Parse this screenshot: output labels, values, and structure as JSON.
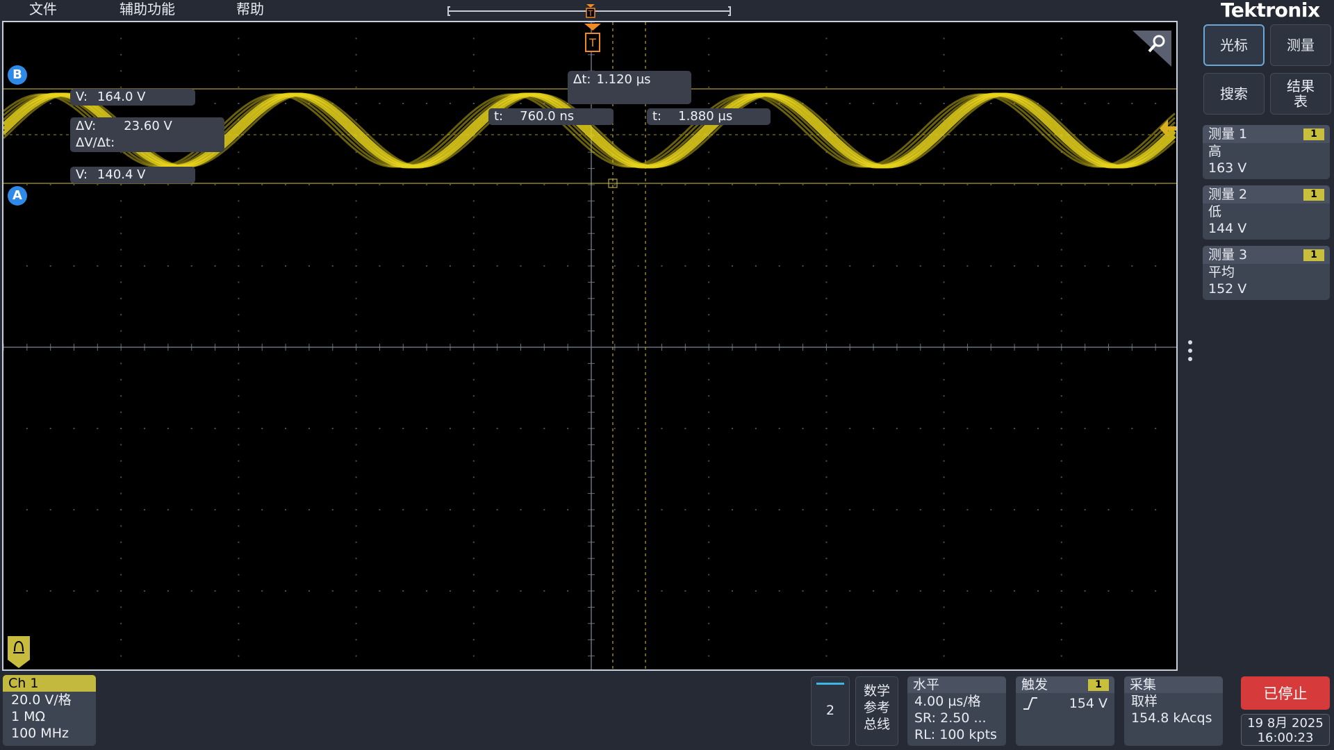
{
  "menu": {
    "file": "文件",
    "utility": "辅助功能",
    "help": "帮助"
  },
  "brand": "Tektronix",
  "trigger_marker": "T",
  "cursor_readouts": {
    "delta_t_label": "Δt:",
    "delta_t": "1.120 µs",
    "t1_label": "t:",
    "t1": "760.0 ns",
    "t2_label": "t:",
    "t2": "1.880 µs",
    "v_top_label": "V:",
    "v_top": "164.0 V",
    "delta_v_label": "ΔV:",
    "delta_v": "23.60 V",
    "dvdt_label": "ΔV/Δt:",
    "v_bottom_label": "V:",
    "v_bottom": "140.4 V",
    "badge_b": "B",
    "badge_a": "A"
  },
  "side": {
    "cursor_btn": "光标",
    "measure_btn": "测量",
    "search_btn": "搜索",
    "results_btn_line1": "结果",
    "results_btn_line2": "表",
    "measurements": [
      {
        "title": "测量 1",
        "chip": "1",
        "name": "高",
        "value": "163 V"
      },
      {
        "title": "测量 2",
        "chip": "1",
        "name": "低",
        "value": "144 V"
      },
      {
        "title": "测量 3",
        "chip": "1",
        "name": "平均",
        "value": "152 V"
      }
    ]
  },
  "bottom": {
    "channel": {
      "name": "Ch 1",
      "scale": "20.0 V/格",
      "impedance": "1 MΩ",
      "bandwidth": "100 MHz"
    },
    "add_new": "2",
    "math_ref_bus": [
      "数学",
      "参考",
      "总线"
    ],
    "horizontal": {
      "title": "水平",
      "scale": "4.00 µs/格",
      "sr": "SR: 2.50 ...",
      "rl": "RL: 100 kpts"
    },
    "trigger": {
      "title": "触发",
      "chip": "1",
      "level": "154 V"
    },
    "acquire": {
      "title": "采集",
      "mode": "取样",
      "count": "154.8 kAcqs"
    },
    "run_state": "已停止",
    "date": "19 8月 2025",
    "time": "16:00:23"
  },
  "colors": {
    "trace": "#e8d41c",
    "accent": "#2e8ae6",
    "stop": "#d63a3a",
    "trigger": "#f08a24"
  }
}
